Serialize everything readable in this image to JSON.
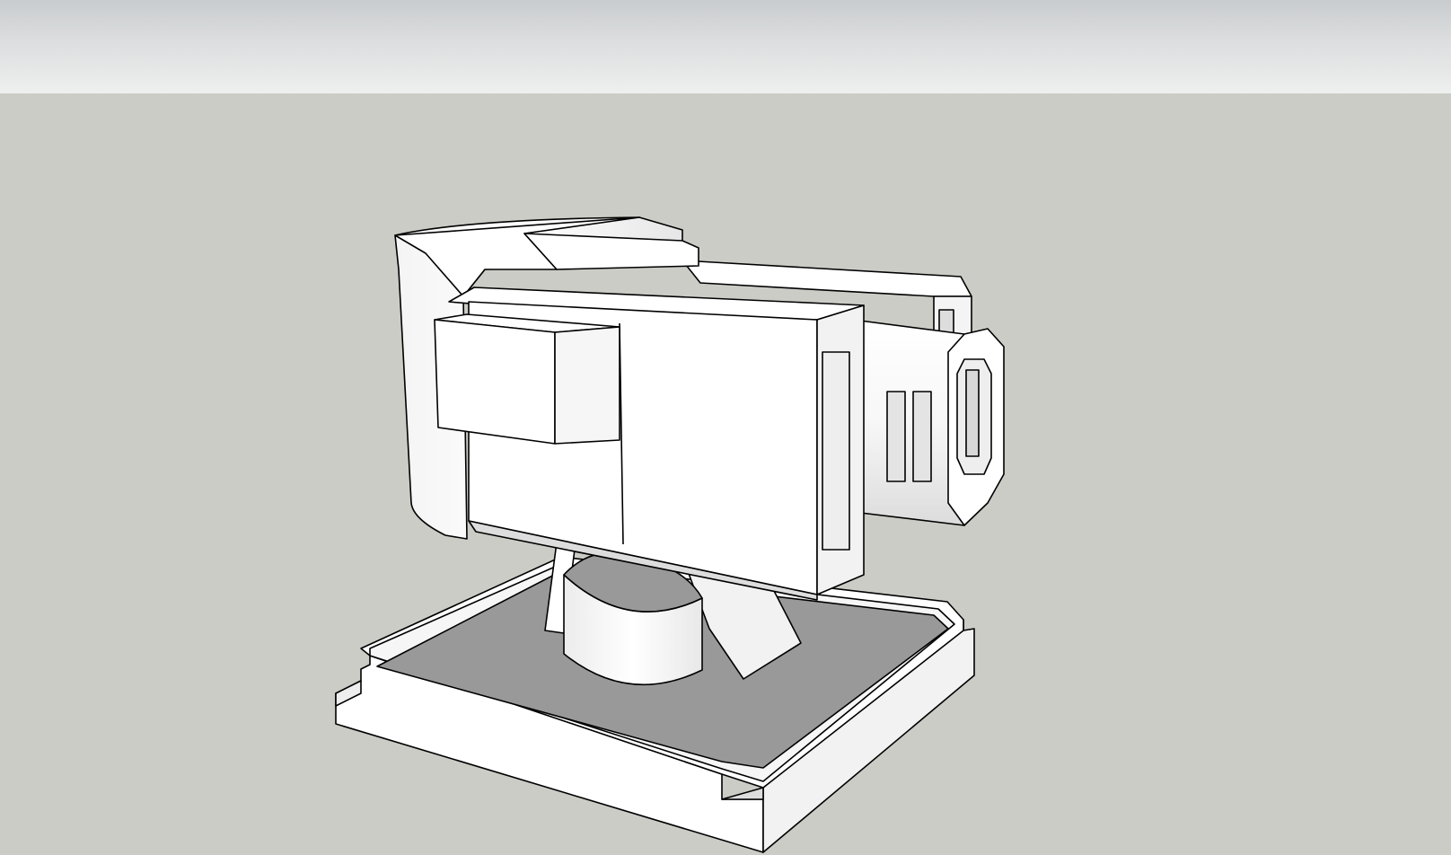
{
  "scene": {
    "sky_gradient": [
      "#c9cccf",
      "#eef0ef"
    ],
    "ground_color": "#cbccc6",
    "face_color_light": "#ffffff",
    "face_color_shade": "#eeeeee",
    "face_color_dark": "#999999",
    "edge_color": "#000000",
    "model_description_name": "turret-model"
  }
}
